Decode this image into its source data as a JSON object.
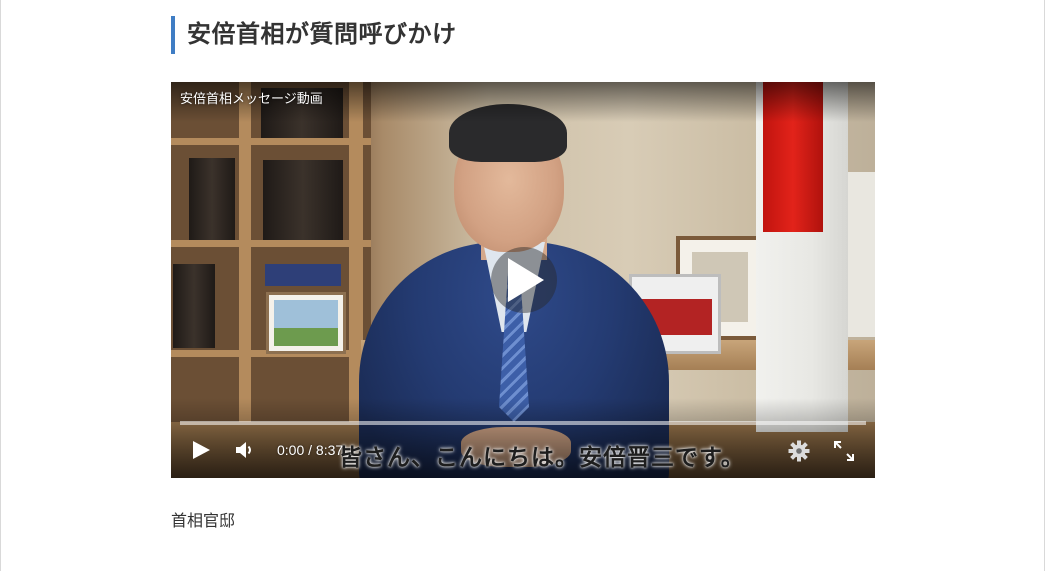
{
  "heading": "安倍首相が質問呼びかけ",
  "video": {
    "title": "安倍首相メッセージ動画",
    "subtitle": "皆さん、こんにちは。安倍晋三です。",
    "time_display": "0:00 / 8:37",
    "progress": 0,
    "icons": {
      "play_large": "play-icon",
      "play": "play-icon",
      "volume": "volume-icon",
      "settings": "gear-icon",
      "fullscreen": "fullscreen-icon"
    }
  },
  "source": "首相官邸",
  "colors": {
    "heading_accent": "#3f7dc4",
    "heading_text": "#333333"
  }
}
